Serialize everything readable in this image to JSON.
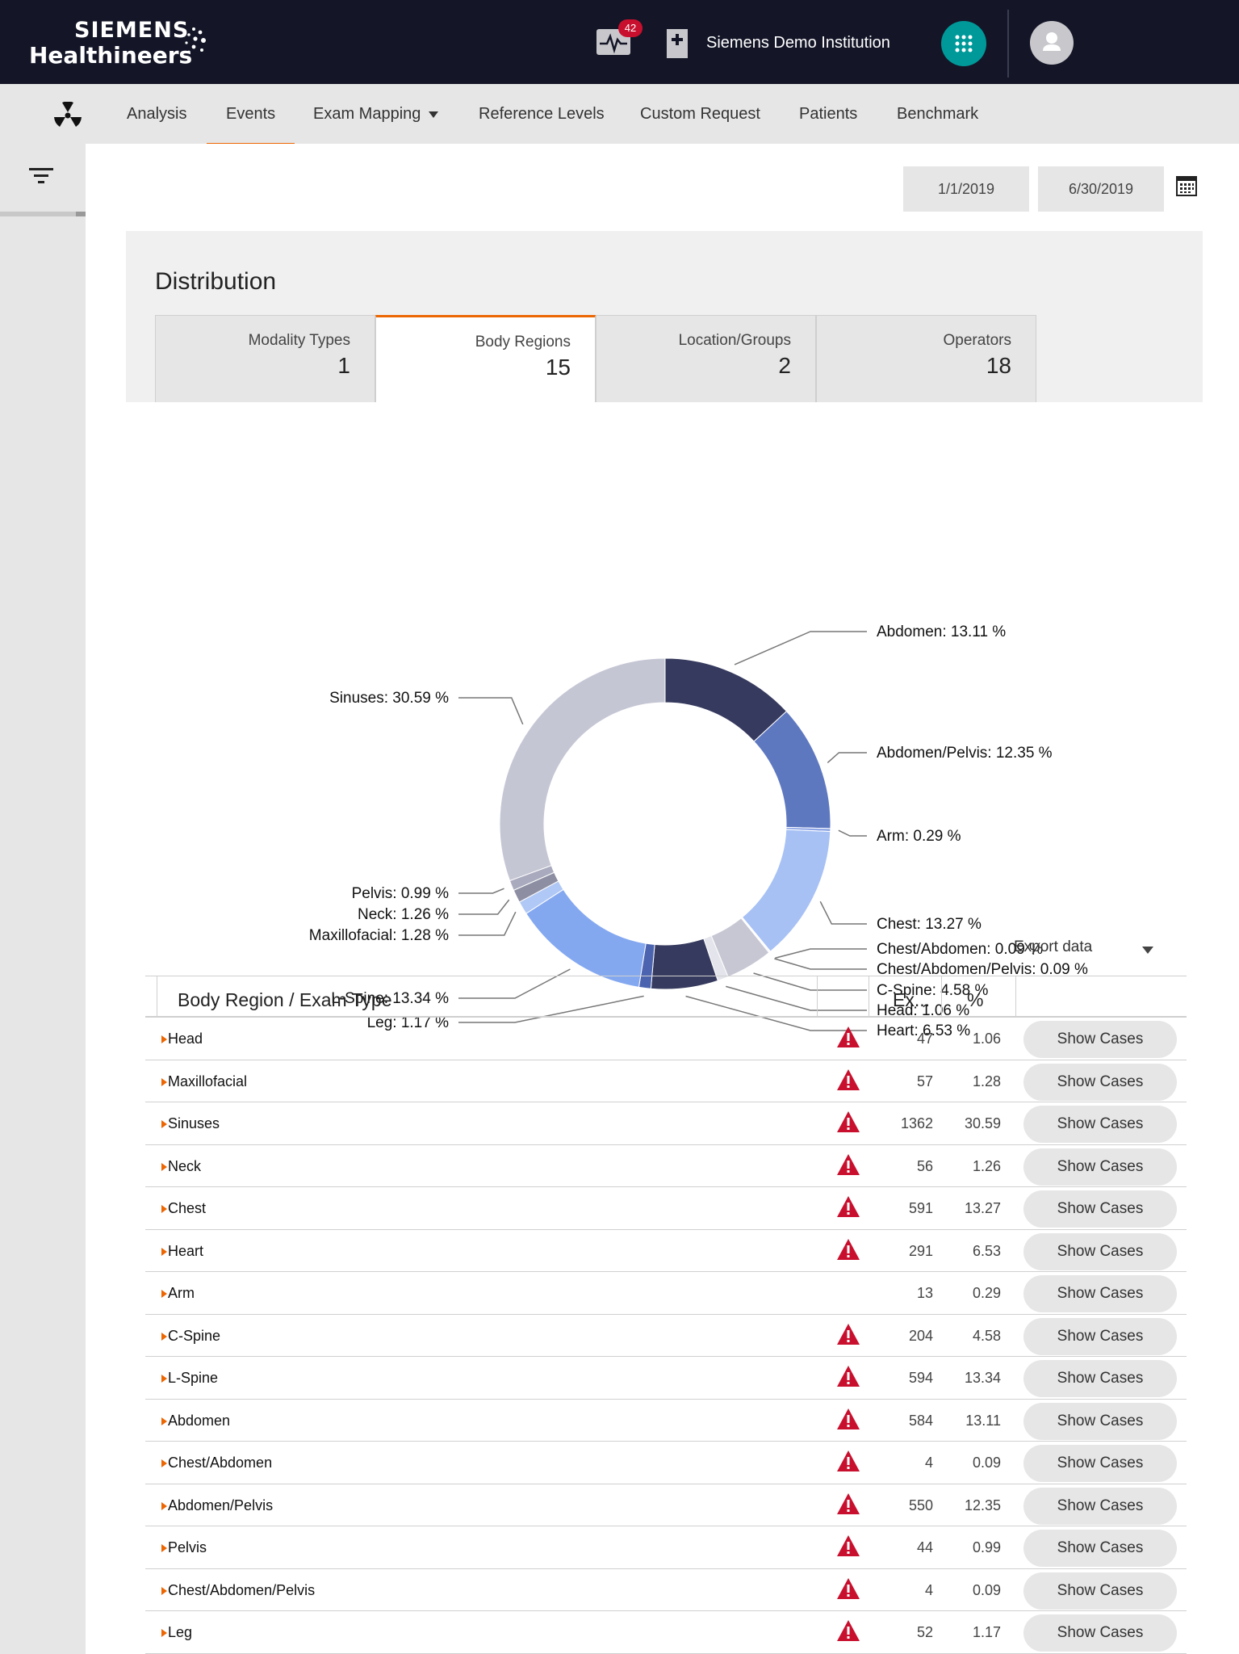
{
  "header": {
    "logo_line1": "SIEMENS",
    "logo_line2": "Healthineers",
    "alert_count": "42",
    "institution": "Siemens Demo Institution",
    "icons": [
      "heartbeat-monitor-icon",
      "hospital-icon",
      "apps-grid-icon",
      "user-icon"
    ]
  },
  "nav": {
    "items": [
      "Analysis",
      "Events",
      "Exam Mapping",
      "Reference Levels",
      "Custom Request",
      "Patients",
      "Benchmark"
    ],
    "active": "Events",
    "accent": "#ec6602"
  },
  "dates": {
    "from": "1/1/2019",
    "to": "6/30/2019"
  },
  "distribution": {
    "title": "Distribution",
    "tabs": [
      {
        "label": "Modality Types",
        "value": "1"
      },
      {
        "label": "Body Regions",
        "value": "15"
      },
      {
        "label": "Location/Groups",
        "value": "2"
      },
      {
        "label": "Operators",
        "value": "18"
      }
    ],
    "active_tab": "Body Regions"
  },
  "chart_data": {
    "type": "pie",
    "variant": "donut",
    "start": "12 o'clock, clockwise",
    "slices": [
      {
        "label": "Abdomen",
        "value": 13.11,
        "text": "Abdomen:  13.11 %",
        "color": "#363a5e"
      },
      {
        "label": "Abdomen/Pelvis",
        "value": 12.35,
        "text": "Abdomen/Pelvis:  12.35 %",
        "color": "#5e78c0"
      },
      {
        "label": "Arm",
        "value": 0.29,
        "text": "Arm:  0.29 %",
        "color": "#8ea6e6"
      },
      {
        "label": "Chest",
        "value": 13.27,
        "text": "Chest:  13.27 %",
        "color": "#a7c1f5"
      },
      {
        "label": "Chest/Abdomen",
        "value": 0.09,
        "text": "Chest/Abdomen:  0.09 %",
        "color": "#d6d8e2"
      },
      {
        "label": "Chest/Abdomen/Pelvis",
        "value": 0.09,
        "text": "Chest/Abdomen/Pelvis:  0.09 %",
        "color": "#c9cad6"
      },
      {
        "label": "C-Spine",
        "value": 4.58,
        "text": "C-Spine:  4.58 %",
        "color": "#c6c7d3"
      },
      {
        "label": "Head",
        "value": 1.06,
        "text": "Head:  1.06 %",
        "color": "#e4e5ec"
      },
      {
        "label": "Heart",
        "value": 6.53,
        "text": "Heart:  6.53 %",
        "color": "#363a5e"
      },
      {
        "label": "Leg",
        "value": 1.17,
        "text": "Leg:  1.17 %",
        "color": "#4c64b0"
      },
      {
        "label": "L-Spine",
        "value": 13.34,
        "text": "L-Spine:  13.34 %",
        "color": "#84a8f0"
      },
      {
        "label": "Maxillofacial",
        "value": 1.28,
        "text": "Maxillofacial:  1.28 %",
        "color": "#b0c8f5"
      },
      {
        "label": "Neck",
        "value": 1.26,
        "text": "Neck:  1.26 %",
        "color": "#8d8ea2"
      },
      {
        "label": "Pelvis",
        "value": 0.99,
        "text": "Pelvis:  0.99 %",
        "color": "#a9aabd"
      },
      {
        "label": "Sinuses",
        "value": 30.59,
        "text": "Sinuses:  30.59 %",
        "color": "#c5c6d4"
      }
    ]
  },
  "export_label": "Export data",
  "table": {
    "columns": [
      "Body Region / Exam Type",
      "",
      "Ex...",
      "%",
      ""
    ],
    "rows": [
      {
        "name": "Head",
        "warning": true,
        "count": "47",
        "pct": "1.06"
      },
      {
        "name": "Maxillofacial",
        "warning": true,
        "count": "57",
        "pct": "1.28"
      },
      {
        "name": "Sinuses",
        "warning": true,
        "count": "1362",
        "pct": "30.59"
      },
      {
        "name": "Neck",
        "warning": true,
        "count": "56",
        "pct": "1.26"
      },
      {
        "name": "Chest",
        "warning": true,
        "count": "591",
        "pct": "13.27"
      },
      {
        "name": "Heart",
        "warning": true,
        "count": "291",
        "pct": "6.53"
      },
      {
        "name": "Arm",
        "warning": false,
        "count": "13",
        "pct": "0.29"
      },
      {
        "name": "C-Spine",
        "warning": true,
        "count": "204",
        "pct": "4.58"
      },
      {
        "name": "L-Spine",
        "warning": true,
        "count": "594",
        "pct": "13.34"
      },
      {
        "name": "Abdomen",
        "warning": true,
        "count": "584",
        "pct": "13.11"
      },
      {
        "name": "Chest/Abdomen",
        "warning": true,
        "count": "4",
        "pct": "0.09"
      },
      {
        "name": "Abdomen/Pelvis",
        "warning": true,
        "count": "550",
        "pct": "12.35"
      },
      {
        "name": "Pelvis",
        "warning": true,
        "count": "44",
        "pct": "0.99"
      },
      {
        "name": "Chest/Abdomen/Pelvis",
        "warning": true,
        "count": "4",
        "pct": "0.09"
      },
      {
        "name": "Leg",
        "warning": true,
        "count": "52",
        "pct": "1.17"
      }
    ],
    "button_label": "Show Cases",
    "warning_color": "#c8102e"
  }
}
